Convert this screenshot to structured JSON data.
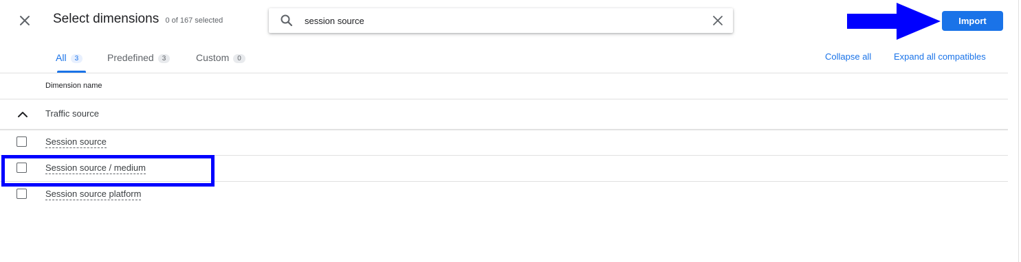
{
  "dialog": {
    "title": "Select dimensions",
    "selected_count": "0 of 167 selected",
    "close_icon": "close-icon"
  },
  "search": {
    "value": "session source",
    "icon": "search-icon",
    "clear_icon": "clear-icon"
  },
  "import_button": {
    "label": "Import",
    "color": "#1a73e8"
  },
  "annotation": {
    "arrow_color": "#0000ff",
    "highlight_color": "#0000ff"
  },
  "tabs": [
    {
      "label": "All",
      "count": "3",
      "active": true
    },
    {
      "label": "Predefined",
      "count": "3",
      "active": false
    },
    {
      "label": "Custom",
      "count": "0",
      "active": false
    }
  ],
  "actions": {
    "collapse_all": "Collapse all",
    "expand_all": "Expand all compatibles"
  },
  "table": {
    "column_header": "Dimension name",
    "group": {
      "label": "Traffic source",
      "expanded": true,
      "icon": "chevron-up-icon"
    },
    "rows": [
      {
        "label": "Session source",
        "checked": false
      },
      {
        "label": "Session source / medium",
        "checked": false,
        "highlighted": true
      },
      {
        "label": "Session source platform",
        "checked": false
      }
    ]
  }
}
